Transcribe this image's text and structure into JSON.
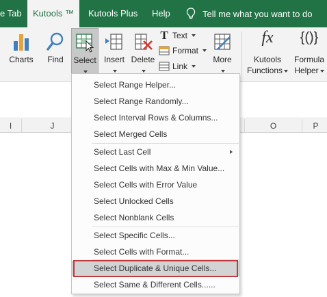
{
  "tabs": {
    "partial": "e Tab",
    "kutools": "Kutools ™",
    "kutools_plus": "Kutools Plus",
    "help": "Help",
    "tell_me": "Tell me what you want to do"
  },
  "ribbon": {
    "charts": "Charts",
    "find": "Find",
    "select": "Select",
    "insert": "Insert",
    "delete": "Delete",
    "text": "Text",
    "format": "Format",
    "link": "Link",
    "more": "More",
    "kutools_functions_1": "Kutools",
    "kutools_functions_2": "Functions",
    "formula_helper_1": "Formula",
    "formula_helper_2": "Helper",
    "fx_glyph": "fx",
    "braces_glyph": "{()}"
  },
  "columns": [
    "I",
    "J",
    "O",
    "P"
  ],
  "menu": {
    "items": [
      "Select Range Helper...",
      "Select Range Randomly...",
      "Select Interval Rows & Columns...",
      "Select Merged Cells",
      "Select Last Cell",
      "Select Cells with Max & Min Value...",
      "Select Cells with Error Value",
      "Select Unlocked Cells",
      "Select Nonblank Cells",
      "Select Specific Cells...",
      "Select Cells with Format...",
      "Select Duplicate & Unique Cells...",
      "Select Same & Different Cells......"
    ],
    "highlighted_index": 11,
    "highlight_border_color": "#c0393b"
  },
  "colors": {
    "accent": "#217346",
    "ribbon_bg": "#f3f3f3"
  }
}
